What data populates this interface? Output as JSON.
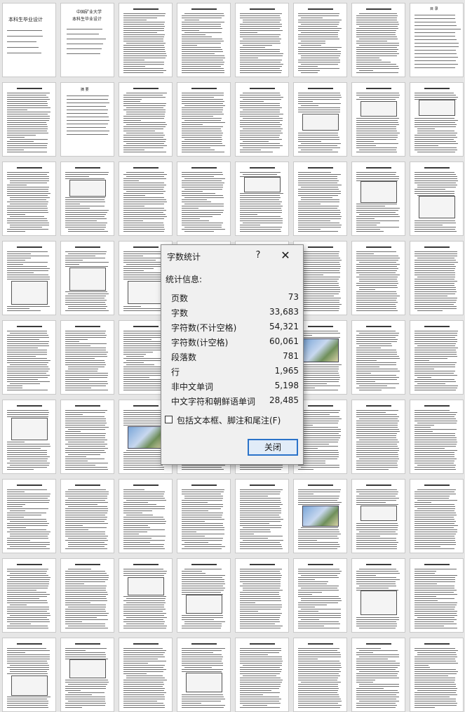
{
  "background_pages": {
    "cover_title": "本科生毕业设计",
    "cover_university": "中国矿业大学",
    "cover_subtitle": "本科生毕业设计",
    "abstract_heading": "摘 要",
    "contents_heading": "目 录"
  },
  "dialog": {
    "title": "字数统计",
    "help_label": "?",
    "close_glyph": "✕",
    "section_label": "统计信息:",
    "stats": [
      {
        "label": "页数",
        "value": "73"
      },
      {
        "label": "字数",
        "value": "33,683"
      },
      {
        "label": "字符数(不计空格)",
        "value": "54,321"
      },
      {
        "label": "字符数(计空格)",
        "value": "60,061"
      },
      {
        "label": "段落数",
        "value": "781"
      },
      {
        "label": "行",
        "value": "1,965"
      },
      {
        "label": "非中文单词",
        "value": "5,198"
      },
      {
        "label": "中文字符和朝鲜语单词",
        "value": "28,485"
      }
    ],
    "include_label": "包括文本框、脚注和尾注(F)",
    "include_checked": false,
    "close_button": "关闭"
  },
  "colors": {
    "dialog_bg": "#f0f0f0",
    "button_border": "#2b73c9",
    "page_bg": "#e6e6e6"
  }
}
